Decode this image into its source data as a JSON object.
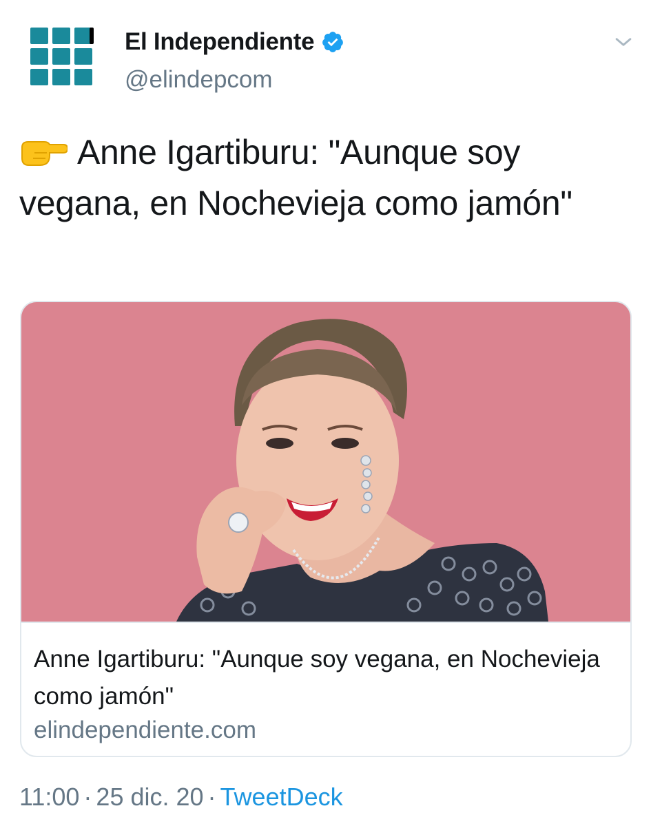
{
  "account": {
    "display_name": "El Independiente",
    "handle": "@elindepcom",
    "verified": true,
    "avatar_icon": "grid-logo-icon",
    "avatar_colors": {
      "primary": "#1a8a9b",
      "accent": "#000000"
    }
  },
  "tweet": {
    "emoji": "backhand-index-pointing-right",
    "text": "Anne Igartiburu: \"Aunque soy vegana, en Nochevieja como jamón\""
  },
  "card": {
    "title": "Anne Igartiburu: \"Aunque soy vegana, en Nochevieja como jamón\"",
    "domain": "elindependiente.com",
    "image_background": "#d9808d"
  },
  "meta": {
    "time": "11:00",
    "separator": "·",
    "date": "25 dic. 20",
    "source": "TweetDeck"
  },
  "colors": {
    "text": "#14171a",
    "secondary": "#657786",
    "link": "#1b95e0",
    "verified": "#1da1f2",
    "border": "#e1e8ed"
  }
}
